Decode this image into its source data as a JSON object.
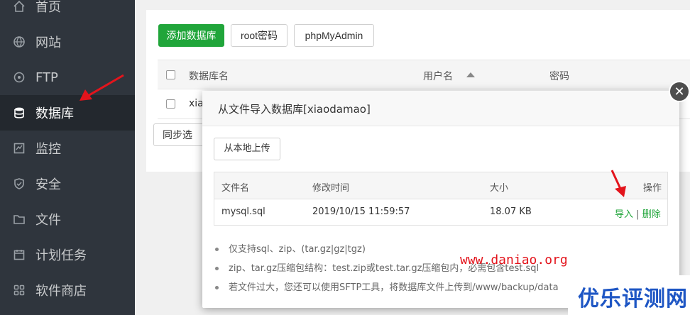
{
  "sidebar": {
    "items": [
      {
        "label": "首页",
        "icon": "home-icon"
      },
      {
        "label": "网站",
        "icon": "globe-icon"
      },
      {
        "label": "FTP",
        "icon": "ftp-icon"
      },
      {
        "label": "数据库",
        "icon": "database-icon",
        "active": true
      },
      {
        "label": "监控",
        "icon": "monitor-icon"
      },
      {
        "label": "安全",
        "icon": "shield-icon"
      },
      {
        "label": "文件",
        "icon": "folder-icon"
      },
      {
        "label": "计划任务",
        "icon": "calendar-icon"
      },
      {
        "label": "软件商店",
        "icon": "apps-icon"
      }
    ]
  },
  "toolbar": {
    "add_db": "添加数据库",
    "root_pwd": "root密码",
    "phpmyadmin": "phpMyAdmin",
    "sync": "同步选"
  },
  "db_table": {
    "headers": [
      "数据库名",
      "用户名",
      "密码"
    ],
    "rows": [
      {
        "name": "xia"
      }
    ]
  },
  "modal": {
    "title": "从文件导入数据库[xiaodamao]",
    "upload_label": "从本地上传",
    "columns": [
      "文件名",
      "修改时间",
      "大小",
      "操作"
    ],
    "files": [
      {
        "name": "mysql.sql",
        "mtime": "2019/10/15 11:59:57",
        "size": "18.07 KB",
        "import": "导入",
        "sep": "|",
        "delete": "删除"
      }
    ],
    "tips": [
      "仅支持sql、zip、(tar.gz|gz|tgz)",
      "zip、tar.gz压缩包结构：test.zip或test.tar.gz压缩包内，必需包含test.sql",
      "若文件过大，您还可以使用SFTP工具，将数据库文件上传到/www/backup/data"
    ]
  },
  "watermark": {
    "url": "www.daniao.org",
    "logo": "优乐评测网"
  },
  "colors": {
    "sidebar_bg": "#2f353d",
    "sidebar_active": "#23282e",
    "primary_green": "#20a53a",
    "annotation_red": "#e3141c",
    "logo_blue": "#1e56c4"
  }
}
